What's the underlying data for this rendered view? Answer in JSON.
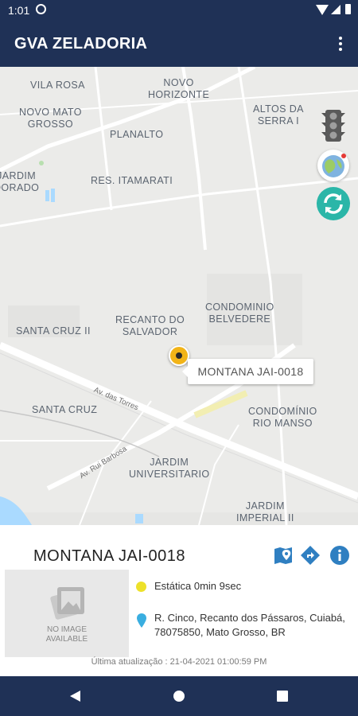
{
  "status_bar": {
    "time": "1:01"
  },
  "app_bar": {
    "title": "GVA ZELADORIA",
    "menu_icon": "more-vert-icon"
  },
  "map": {
    "labels": [
      {
        "id": "vila-rosa",
        "text": "VILA ROSA"
      },
      {
        "id": "novo-horizonte",
        "text": "NOVO\nHORIZONTE"
      },
      {
        "id": "novo-mato-grosso",
        "text": "NOVO MATO\nGROSSO"
      },
      {
        "id": "altos-da-serra",
        "text": "ALTOS DA\nSERRA I"
      },
      {
        "id": "planalto",
        "text": "PLANALTO"
      },
      {
        "id": "jardim-dorado",
        "text": "JARDIM\nDORADO"
      },
      {
        "id": "res-itamarati",
        "text": "RES. ITAMARATI"
      },
      {
        "id": "recanto-do-salvador",
        "text": "RECANTO DO\nSALVADOR"
      },
      {
        "id": "condominio-belvedere",
        "text": "CONDOMINIO\nBELVEDERE"
      },
      {
        "id": "santa-cruz-ii",
        "text": "SANTA CRUZ II"
      },
      {
        "id": "santa-cruz",
        "text": "SANTA CRUZ"
      },
      {
        "id": "condominio-rio-manso",
        "text": "CONDOMÍNIO\nRIO MANSO"
      },
      {
        "id": "jardim-universitario",
        "text": "JARDIM\nUNIVERSITARIO"
      },
      {
        "id": "jardim-imperial",
        "text": "JARDIM\nIMPERIAL II"
      }
    ],
    "road_labels": {
      "torres": "Av. das Torres",
      "rui_barbosa": "Av. Rui Barbosa"
    },
    "marker_label": "MONTANA JAI-0018",
    "controls": {
      "traffic": "traffic-light-icon",
      "globe": "globe-icon",
      "refresh": "refresh-icon"
    }
  },
  "vehicle": {
    "name": "MONTANA JAI-0018",
    "actions": [
      "map-pin-icon",
      "directions-icon",
      "info-icon"
    ],
    "image_placeholder": "NO IMAGE\nAVAILABLE",
    "status": "Estática 0min 9sec",
    "status_color": "#ede12a",
    "address": "R. Cinco, Recanto dos Pássaros, Cuiabá, 78075850, Mato Grosso, BR",
    "last_update": "Última atualização : 21-04-2021 01:00:59 PM"
  },
  "colors": {
    "primary": "#1f3156",
    "accent": "#2bb6a8",
    "action_blue": "#2f7fc1"
  }
}
